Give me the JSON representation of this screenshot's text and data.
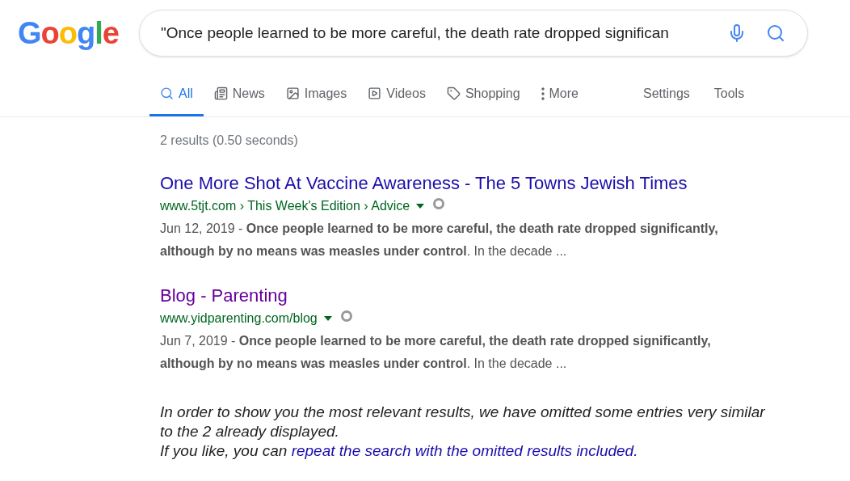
{
  "logo": "Google",
  "search": {
    "value": "\"Once people learned to be more careful, the death rate dropped significan"
  },
  "tabs": [
    {
      "label": "All",
      "kind": "all",
      "selected": true
    },
    {
      "label": "News",
      "kind": "news",
      "selected": false
    },
    {
      "label": "Images",
      "kind": "images",
      "selected": false
    },
    {
      "label": "Videos",
      "kind": "videos",
      "selected": false
    },
    {
      "label": "Shopping",
      "kind": "shopping",
      "selected": false
    },
    {
      "label": "More",
      "kind": "more",
      "selected": false
    }
  ],
  "tools": [
    "Settings",
    "Tools"
  ],
  "result_stats": "2 results (0.50 seconds)",
  "results": [
    {
      "title": "One More Shot At Vaccine Awareness - The 5 Towns Jewish Times",
      "visited": false,
      "url": "www.5tjt.com › This Week's Edition › Advice",
      "date": "Jun 12, 2019 - ",
      "snippet": "**Once people learned to be more careful, the death rate dropped significantly, although by no means was measles under control**. In the decade ..."
    },
    {
      "title": "Blog - Parenting",
      "visited": true,
      "url": "www.yidparenting.com/blog",
      "date": "Jun 7, 2019 - ",
      "snippet": "**Once people learned to be more careful, the death rate dropped significantly, although by no means was measles under control**. In the decade ..."
    }
  ],
  "omitted": {
    "sentence": "In order to show you the most relevant results, we have omitted some entries very similar to the 2 already displayed.",
    "prefix": "If you like, you can ",
    "link": "repeat the search with the omitted results included."
  }
}
